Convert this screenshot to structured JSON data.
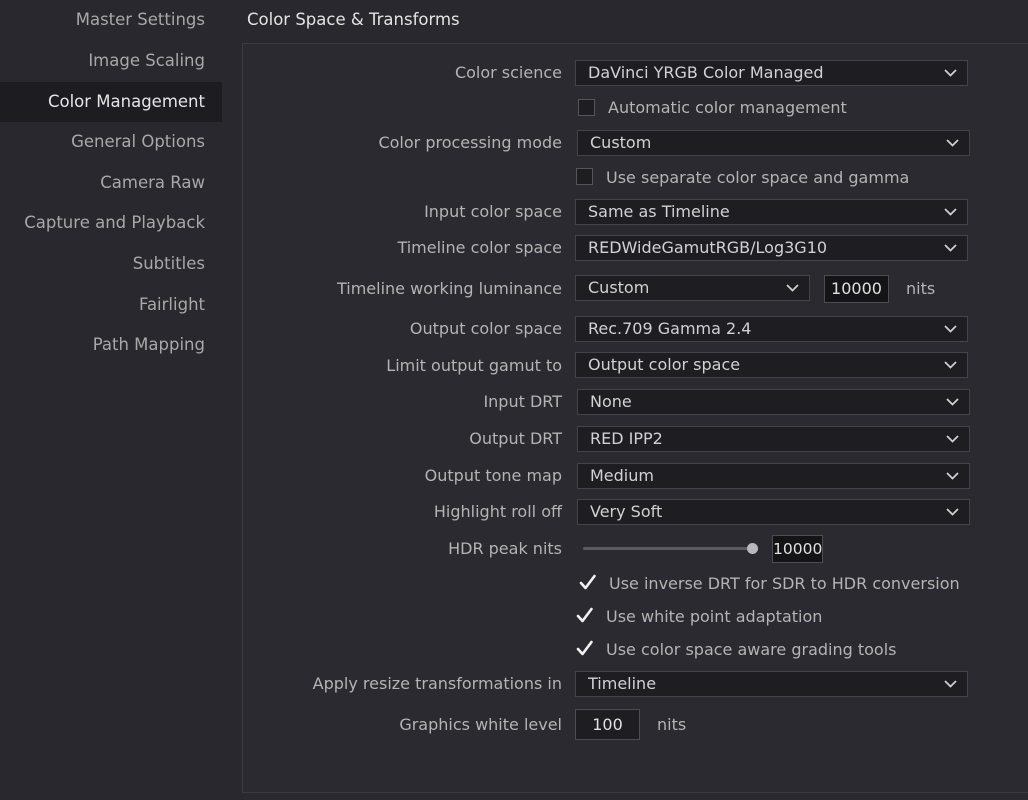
{
  "sidebar": {
    "items": [
      {
        "label": "Master Settings"
      },
      {
        "label": "Image Scaling"
      },
      {
        "label": "Color Management"
      },
      {
        "label": "General Options"
      },
      {
        "label": "Camera Raw"
      },
      {
        "label": "Capture and Playback"
      },
      {
        "label": "Subtitles"
      },
      {
        "label": "Fairlight"
      },
      {
        "label": "Path Mapping"
      }
    ],
    "active_index": 2
  },
  "section": {
    "title": "Color Space & Transforms"
  },
  "settings": {
    "color_science": {
      "label": "Color science",
      "value": "DaVinci YRGB Color Managed"
    },
    "auto_color_management": {
      "label": "Automatic color management",
      "checked": false
    },
    "color_processing_mode": {
      "label": "Color processing mode",
      "value": "Custom"
    },
    "separate_color_space_gamma": {
      "label": "Use separate color space and gamma",
      "checked": false
    },
    "input_color_space": {
      "label": "Input color space",
      "value": "Same as Timeline"
    },
    "timeline_color_space": {
      "label": "Timeline color space",
      "value": "REDWideGamutRGB/Log3G10"
    },
    "timeline_working_luminance": {
      "label": "Timeline working luminance",
      "value": "Custom",
      "nits_value": "10000",
      "unit": "nits"
    },
    "output_color_space": {
      "label": "Output color space",
      "value": "Rec.709 Gamma 2.4"
    },
    "limit_output_gamut": {
      "label": "Limit output gamut to",
      "value": "Output color space"
    },
    "input_drt": {
      "label": "Input DRT",
      "value": "None"
    },
    "output_drt": {
      "label": "Output DRT",
      "value": "RED IPP2"
    },
    "output_tone_map": {
      "label": "Output tone map",
      "value": "Medium"
    },
    "highlight_roll_off": {
      "label": "Highlight roll off",
      "value": "Very Soft"
    },
    "hdr_peak_nits": {
      "label": "HDR peak nits",
      "value": "10000",
      "slider_fraction": 1.0
    },
    "inverse_drt": {
      "label": "Use inverse DRT for SDR to HDR conversion",
      "checked": true
    },
    "white_point_adaptation": {
      "label": "Use white point adaptation",
      "checked": true
    },
    "color_space_aware_tools": {
      "label": "Use color space aware grading tools",
      "checked": true
    },
    "resize_transformations": {
      "label": "Apply resize transformations in",
      "value": "Timeline"
    },
    "graphics_white_level": {
      "label": "Graphics white level",
      "value": "100",
      "unit": "nits"
    }
  },
  "icons": {
    "dropdown": "chevron-down-icon",
    "check": "checkmark-icon"
  },
  "colors": {
    "background": "#28282e",
    "active_nav": "#1d1d21",
    "field": "#1d1d22"
  }
}
